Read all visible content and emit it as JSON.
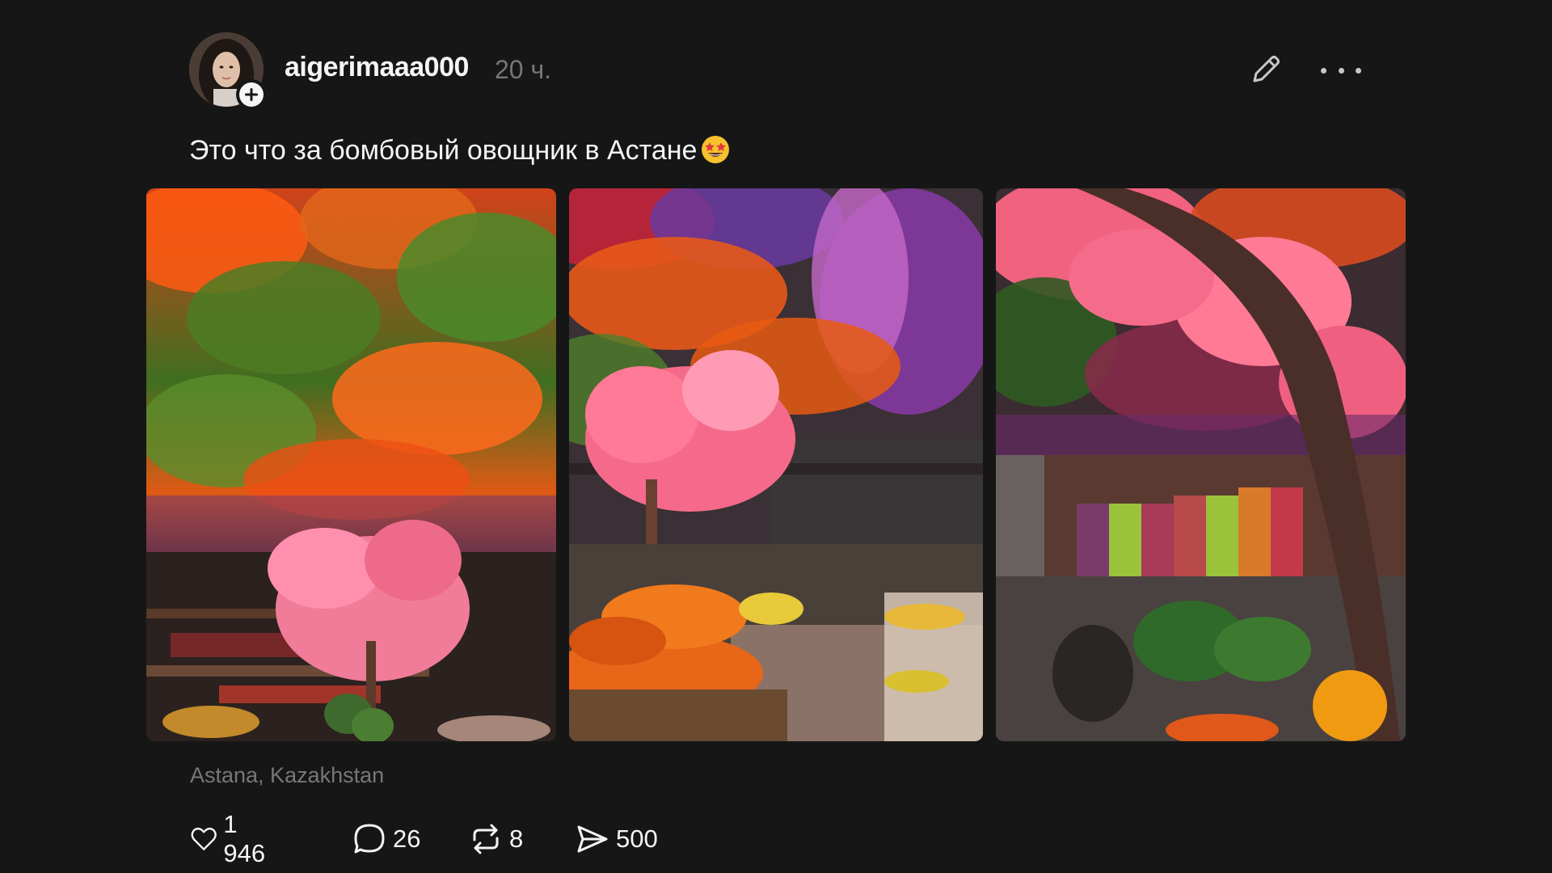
{
  "post": {
    "author": {
      "username": "aigerimaaa000",
      "avatar_icon": "profile-photo",
      "follow_icon": "plus-icon"
    },
    "time": "20 ч.",
    "caption": "Это что за бомбовый овощник в Астане",
    "caption_emoji": "star-struck-emoji",
    "images": [
      {
        "description_icon": "photo-flower-ceiling-store"
      },
      {
        "description_icon": "photo-fruit-counter-pink-tree"
      },
      {
        "description_icon": "photo-fruit-shelves-pink-tree"
      }
    ],
    "location": "Astana, Kazakhstan",
    "stats": {
      "likes": "1 946",
      "comments": "26",
      "reposts": "8",
      "shares": "500"
    }
  },
  "colors": {
    "background": "#161616",
    "text_primary": "#f3f5f7",
    "text_secondary": "#777777"
  }
}
